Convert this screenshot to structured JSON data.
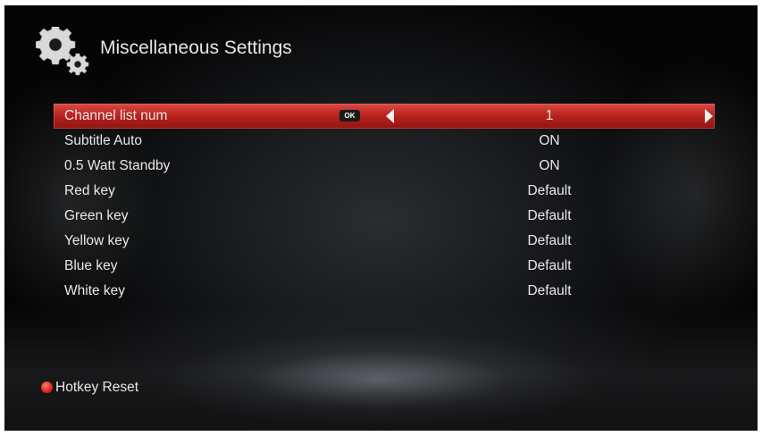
{
  "header": {
    "title": "Miscellaneous Settings",
    "icon": "gears-icon"
  },
  "menu": {
    "items": [
      {
        "label": "Channel list num",
        "value": "1",
        "selected": true
      },
      {
        "label": "Subtitle Auto",
        "value": "ON"
      },
      {
        "label": "0.5 Watt Standby",
        "value": "ON"
      },
      {
        "label": "Red key",
        "value": "Default"
      },
      {
        "label": "Green key",
        "value": "Default"
      },
      {
        "label": "Yellow key",
        "value": "Default"
      },
      {
        "label": "Blue key",
        "value": "Default"
      },
      {
        "label": "White key",
        "value": "Default"
      }
    ],
    "ok_badge": "OK"
  },
  "footer": {
    "hotkey_label": "Hotkey Reset",
    "hotkey_color": "#e3241a"
  },
  "colors": {
    "selected_row": "#c0302a",
    "text": "#e8e8e8"
  }
}
